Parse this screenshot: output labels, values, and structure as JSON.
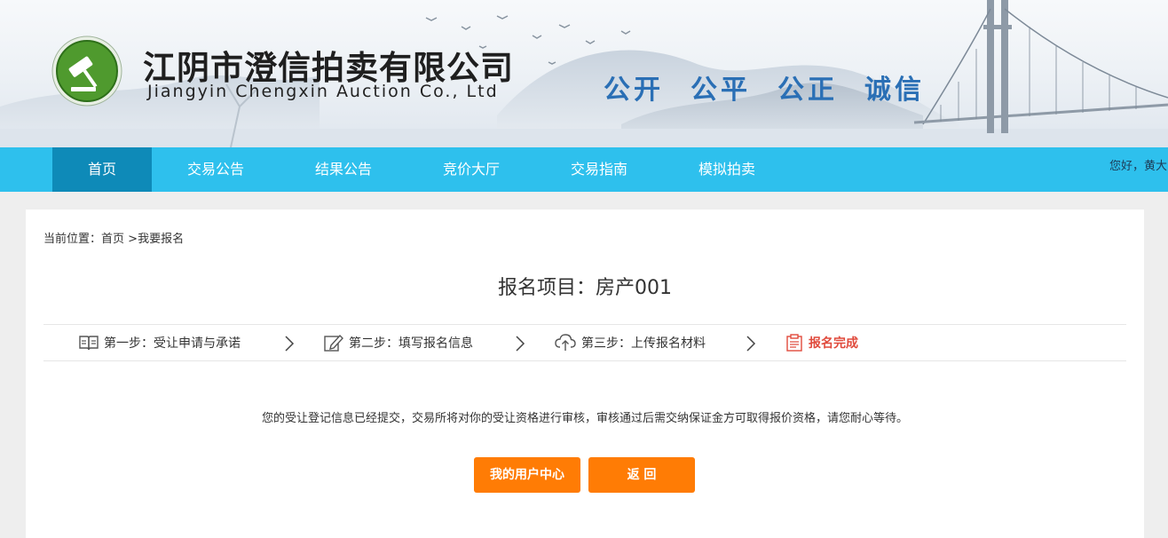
{
  "header": {
    "company_name_cn": "江阴市澄信拍卖有限公司",
    "company_name_en": "Jiangyin Chengxin Auction Co., Ltd",
    "slogans": [
      "公开",
      "公平",
      "公正",
      "诚信"
    ],
    "logo_icon": "auction-gavel-icon"
  },
  "nav": {
    "items": [
      {
        "label": "首页",
        "active": true
      },
      {
        "label": "交易公告",
        "active": false
      },
      {
        "label": "结果公告",
        "active": false
      },
      {
        "label": "竞价大厅",
        "active": false
      },
      {
        "label": "交易指南",
        "active": false
      },
      {
        "label": "模拟拍卖",
        "active": false
      }
    ],
    "user_greeting": "您好，黄大"
  },
  "breadcrumb": {
    "prefix": "当前位置：",
    "home": "首页",
    "separator": " >",
    "current": "我要报名"
  },
  "project": {
    "title": "报名项目：房产001"
  },
  "steps": [
    {
      "label": "第一步：受让申请与承诺",
      "icon": "book-icon",
      "status": "done"
    },
    {
      "label": "第二步：填写报名信息",
      "icon": "edit-icon",
      "status": "done"
    },
    {
      "label": "第三步：上传报名材料",
      "icon": "cloud-upload-icon",
      "status": "done"
    },
    {
      "label": "报名完成",
      "icon": "clipboard-icon",
      "status": "current"
    }
  ],
  "notice": "您的受让登记信息已经提交，交易所将对你的受让资格进行审核，审核通过后需交纳保证金方可取得报价资格，请您耐心等待。",
  "buttons": {
    "user_center": "我的用户中心",
    "back": "返 回"
  },
  "colors": {
    "nav_bg": "#2ec0ed",
    "nav_active": "#0e8ab8",
    "slogan": "#2a6fb5",
    "button": "#ff7c05",
    "step_current": "#e04a3c",
    "page_bg": "#eeeeee"
  }
}
